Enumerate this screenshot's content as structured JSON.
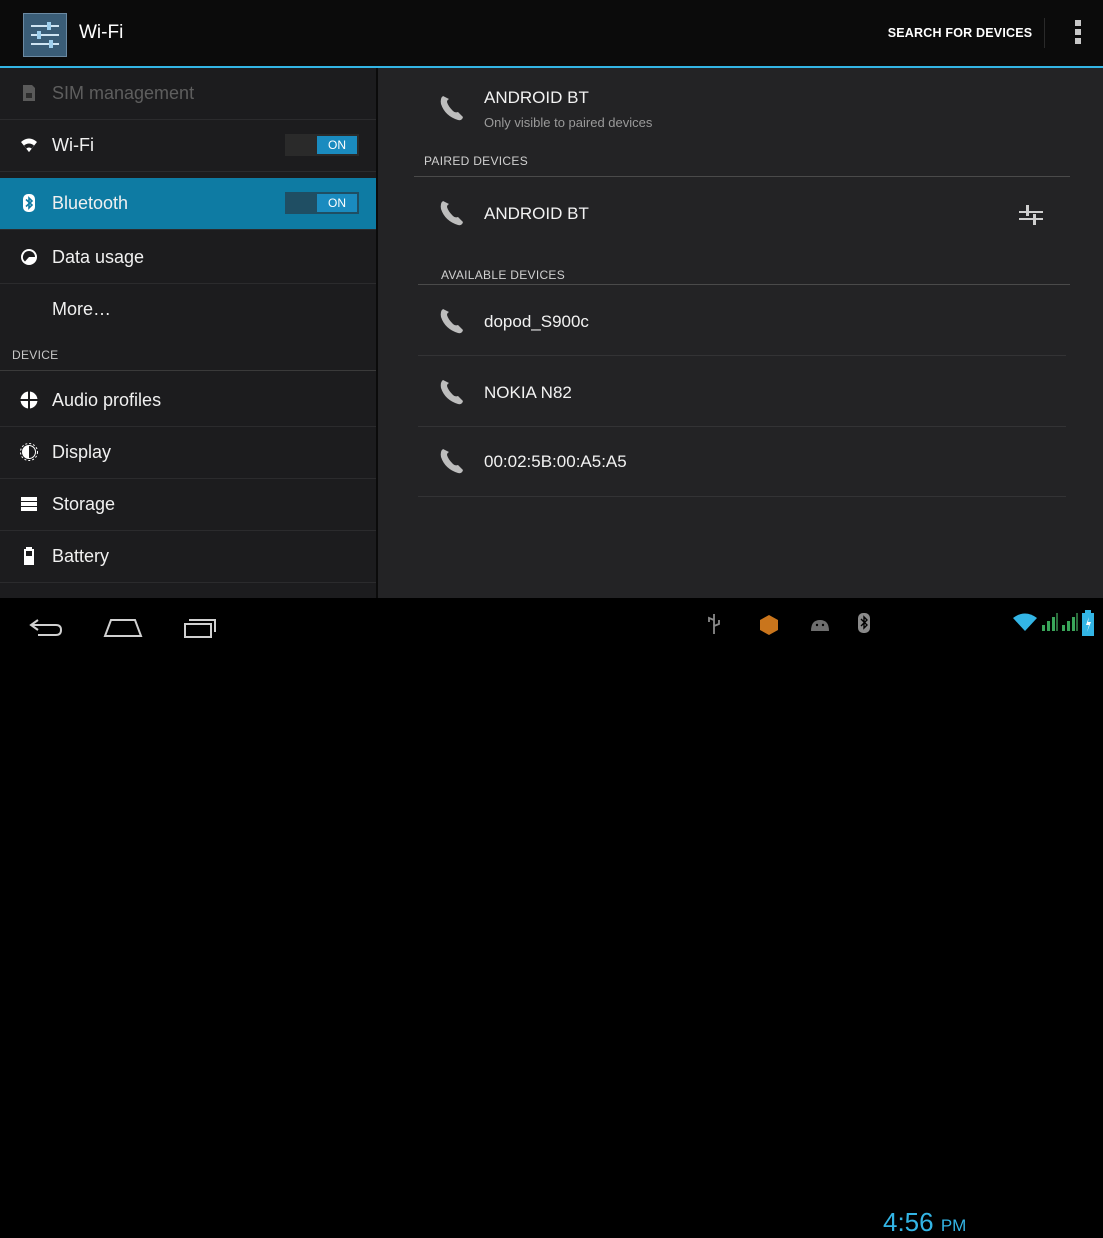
{
  "action_bar": {
    "title": "Wi-Fi",
    "search_label": "SEARCH FOR DEVICES",
    "app_icon": "settings-sliders-icon",
    "overflow_icon": "overflow-menu-icon",
    "accent_color": "#33b5e5"
  },
  "sidebar": {
    "items": [
      {
        "label": "SIM management",
        "icon": "sim-icon",
        "dimmed": true
      },
      {
        "label": "Wi-Fi",
        "icon": "wifi-icon",
        "toggle": "ON"
      },
      {
        "label": "Bluetooth",
        "icon": "bluetooth-icon",
        "toggle": "ON",
        "active": true
      },
      {
        "label": "Data usage",
        "icon": "data-usage-icon"
      },
      {
        "label": "More…"
      }
    ],
    "device_header": "DEVICE",
    "device_items": [
      {
        "label": "Audio profiles",
        "icon": "audio-profiles-icon"
      },
      {
        "label": "Display",
        "icon": "display-icon"
      },
      {
        "label": "Storage",
        "icon": "storage-icon"
      },
      {
        "label": "Battery",
        "icon": "battery-icon"
      }
    ],
    "active_color": "#0e7ba3"
  },
  "bluetooth": {
    "this_device": {
      "name": "ANDROID BT",
      "status": "Only visible to paired devices"
    },
    "paired_header": "PAIRED DEVICES",
    "paired": [
      {
        "name": "ANDROID BT",
        "action_icon": "device-settings-icon"
      }
    ],
    "available_header": "AVAILABLE DEVICES",
    "available": [
      {
        "name": "dopod_S900c"
      },
      {
        "name": "NOKIA N82"
      },
      {
        "name": "00:02:5B:00:A5:A5"
      }
    ],
    "device_icon": "phone-icon"
  },
  "status_bar": {
    "time": "4:56",
    "ampm": "PM",
    "nav_icons": [
      "back-icon",
      "home-icon",
      "recent-apps-icon"
    ],
    "notification_icons": [
      "usb-icon",
      "orange-notification-icon",
      "android-debug-icon",
      "bluetooth-status-icon",
      "wifi-signal-icon",
      "cell-signal-icon",
      "cell-signal-icon",
      "battery-status-icon"
    ]
  }
}
